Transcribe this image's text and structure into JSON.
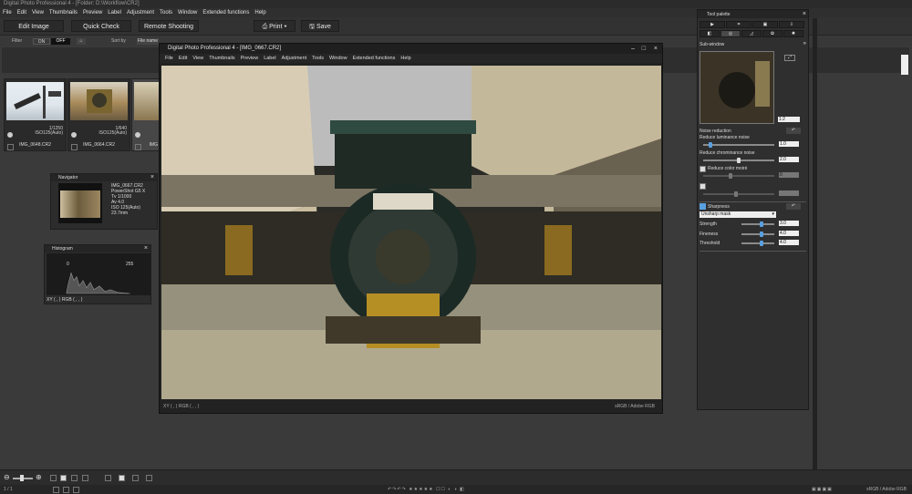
{
  "app": {
    "title": "Digital Photo Professional 4 - [Folder: D:\\Workflow\\CR2]"
  },
  "menubar": [
    "File",
    "Edit",
    "View",
    "Thumbnails",
    "Preview",
    "Label",
    "Adjustment",
    "Tools",
    "Window",
    "Extended functions",
    "Help"
  ],
  "toolbar": {
    "edit_image": "Edit Image",
    "quick_check": "Quick Check",
    "remote_shooting": "Remote Shooting",
    "print": "Print",
    "save": "Save"
  },
  "filterbar": {
    "filter_label": "Filter",
    "on": "ON",
    "off": "OFF",
    "sort_label": "Sort by",
    "sort_value": "File name"
  },
  "thumbnails": [
    {
      "shutter": "1/1250",
      "iso": "ISO125(Auto)",
      "name": "IMG_0648.CR2"
    },
    {
      "shutter": "1/640",
      "iso": "ISO125(Auto)",
      "name": "IMG_0664.CR2"
    },
    {
      "shutter": "",
      "iso": "",
      "name": "IMG"
    }
  ],
  "navigator": {
    "title": "Navigator",
    "info": [
      "IMG_0667.CR2",
      "PowerShot G5 X",
      "Tv 1/1000",
      "Av 4.0",
      "ISO 125(Auto)",
      "23.7mm"
    ]
  },
  "histogram": {
    "title": "Histogram",
    "min": "0",
    "max": "255",
    "readout": "XY ( , ) RGB ( , , )"
  },
  "main_window": {
    "title": "Digital Photo Professional 4 - [IMG_0667.CR2]",
    "menu": [
      "File",
      "Edit",
      "View",
      "Thumbnails",
      "Preview",
      "Label",
      "Adjustment",
      "Tools",
      "Window",
      "Extended functions",
      "Help"
    ],
    "readout": "XY ( , ) RGB ( , , )",
    "color_space": "sRGB / Adobe RGB"
  },
  "tool_palette": {
    "title": "Tool palette",
    "subwindow": "Sub-window",
    "zoom": "1:2",
    "noise_reduction": "Noise reduction",
    "luminance_label": "Reduce luminance noise",
    "luminance_value": "1.0",
    "luminance_level": 0.1,
    "chrominance_label": "Reduce chrominance noise",
    "chrominance_value": "2.0",
    "chrominance_level": 0.5,
    "color_moire_label": "Reduce color moiré",
    "color_moire_value": "0",
    "sharpness_title": "Sharpness",
    "sharpness_mode": "Unsharp mask",
    "strength_label": "Strength",
    "strength_value": "3.0",
    "strength_level": 0.6,
    "fineness_label": "Fineness",
    "fineness_value": "4.0",
    "fineness_level": 0.6,
    "threshold_label": "Threshold",
    "threshold_value": "4.0",
    "threshold_level": 0.6
  },
  "status": {
    "page": "1 / 1",
    "color_space": "sRGB / Adobe RGB"
  },
  "colors": {
    "accent": "#5aa0e0",
    "background": "#3a3a3a"
  }
}
